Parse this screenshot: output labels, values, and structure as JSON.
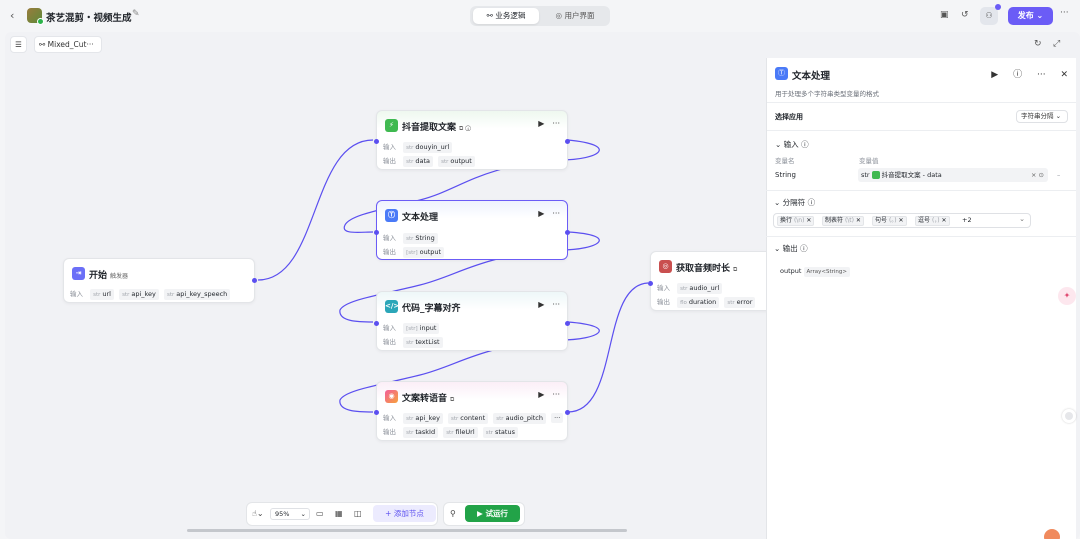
{
  "header": {
    "back": "‹",
    "app_title": "茶艺混剪・视频生成",
    "tabs": [
      {
        "label": "业务逻辑",
        "icon": "flow-icon"
      },
      {
        "label": "用户界面",
        "icon": "eye-icon"
      }
    ],
    "publish_label": "发布"
  },
  "canvas": {
    "flow_name": "Mixed_Cut···",
    "zoom": "95%",
    "add_node_label": "添加节点",
    "run_label": "试运行"
  },
  "nodes": {
    "start": {
      "title": "开始",
      "tag": "触发器",
      "input_label": "输入",
      "inputs": [
        {
          "type": "str",
          "name": "url"
        },
        {
          "type": "str",
          "name": "api_key"
        },
        {
          "type": "str",
          "name": "api_key_speech"
        }
      ]
    },
    "douyin": {
      "title": "抖音提取文案",
      "input_label": "输入",
      "output_label": "输出",
      "inputs": [
        {
          "type": "str",
          "name": "douyin_url"
        }
      ],
      "outputs": [
        {
          "type": "str",
          "name": "data"
        },
        {
          "type": "str",
          "name": "output"
        }
      ]
    },
    "text": {
      "title": "文本处理",
      "input_label": "输入",
      "output_label": "输出",
      "inputs": [
        {
          "type": "str",
          "name": "String"
        }
      ],
      "outputs": [
        {
          "type": "[str]",
          "name": "output"
        }
      ]
    },
    "code": {
      "title": "代码_字幕对齐",
      "input_label": "输入",
      "output_label": "输出",
      "inputs": [
        {
          "type": "[str]",
          "name": "input"
        }
      ],
      "outputs": [
        {
          "type": "str",
          "name": "textList"
        }
      ]
    },
    "tts": {
      "title": "文案转语音",
      "input_label": "输入",
      "output_label": "输出",
      "inputs": [
        {
          "type": "str",
          "name": "api_key"
        },
        {
          "type": "str",
          "name": "content"
        },
        {
          "type": "str",
          "name": "audio_pitch"
        }
      ],
      "outputs": [
        {
          "type": "str",
          "name": "taskId"
        },
        {
          "type": "str",
          "name": "fileUrl"
        },
        {
          "type": "str",
          "name": "status"
        }
      ]
    },
    "audio": {
      "title": "获取音频时长",
      "input_label": "输入",
      "output_label": "输出",
      "inputs": [
        {
          "type": "str",
          "name": "audio_url"
        }
      ],
      "outputs": [
        {
          "type": "flo",
          "name": "duration"
        },
        {
          "type": "str",
          "name": "error"
        }
      ]
    }
  },
  "panel": {
    "title": "文本处理",
    "description": "用于处理多个字符串类型变量的格式",
    "select_app_label": "选择应用",
    "select_app_value": "字符串分隔",
    "input_section": "输入",
    "col_var_name": "变量名",
    "col_var_value": "变量值",
    "var_name": "String",
    "var_type": "str",
    "var_ref": "抖音提取文案 - data",
    "separator_section": "分隔符",
    "separators": [
      {
        "label": "换行",
        "hint": "(\\n)"
      },
      {
        "label": "制表符",
        "hint": "(\\t)"
      },
      {
        "label": "句号",
        "hint": "(。)"
      },
      {
        "label": "逗号",
        "hint": "(，)"
      }
    ],
    "separators_more": "+2",
    "output_section": "输出",
    "output_name": "output",
    "output_type": "Array<String>"
  },
  "colors": {
    "accent": "#6b5cf6",
    "run": "#22a348",
    "edge": "#5b4ff0"
  }
}
